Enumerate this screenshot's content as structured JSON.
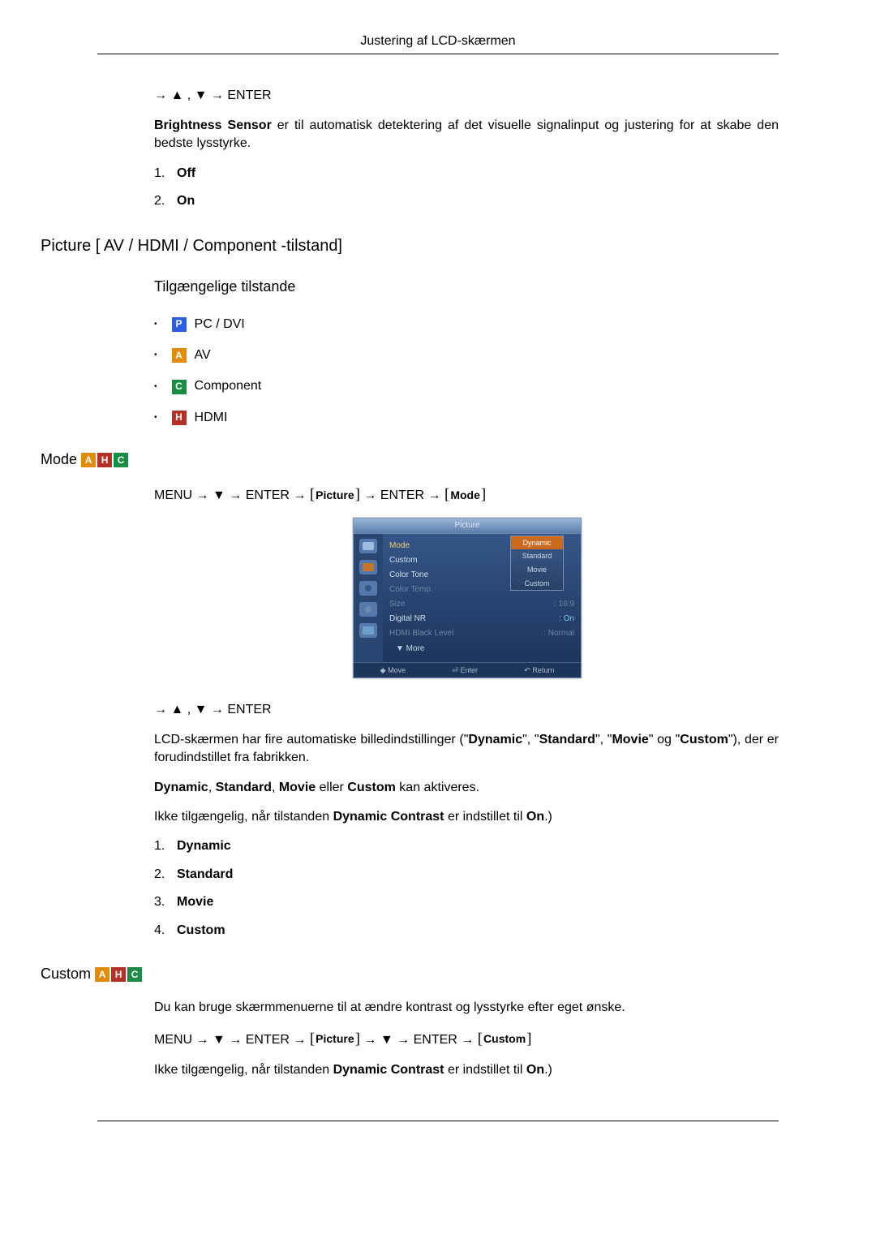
{
  "header": {
    "title": "Justering af LCD-skærmen"
  },
  "section_brightness": {
    "nav": "→ ▲ , ▼ → ENTER",
    "desc_prefix": "Brightness Sensor",
    "desc_rest": "  er til automatisk detektering af det visuelle signalinput og justering for at skabe den bedste lysstyrke.",
    "items": [
      "Off",
      "On"
    ]
  },
  "section_picture": {
    "title": "Picture [ AV / HDMI / Component -tilstand]",
    "subtitle": "Tilgængelige tilstande",
    "modes": [
      {
        "badge": "P",
        "cls": "badge-p",
        "label": "PC / DVI"
      },
      {
        "badge": "A",
        "cls": "badge-a",
        "label": "AV"
      },
      {
        "badge": "C",
        "cls": "badge-c",
        "label": "Component"
      },
      {
        "badge": "H",
        "cls": "badge-h",
        "label": "HDMI"
      }
    ]
  },
  "section_mode": {
    "title": "Mode",
    "nav_plain_1": "MENU → ▼ → ENTER → ",
    "nav_br1": "Picture",
    "nav_plain_2": " → ENTER → ",
    "nav_br2": "Mode",
    "osd": {
      "title": "Picture",
      "rows": [
        {
          "label": "Mode",
          "value": "",
          "high": true
        },
        {
          "label": "Custom",
          "value": ""
        },
        {
          "label": "Color Tone",
          "value": ""
        },
        {
          "label": "Color Temp.",
          "value": "",
          "dim": true
        },
        {
          "label": "Size",
          "value": ": 16:9",
          "dim": true
        },
        {
          "label": "Digital NR",
          "value": ": On"
        },
        {
          "label": "HDMI Black Level",
          "value": ": Normal",
          "dim": true
        }
      ],
      "dropdown": [
        "Dynamic",
        "Standard",
        "Movie",
        "Custom"
      ],
      "dropdown_selected": "Dynamic",
      "more": "▼  More",
      "foot": {
        "move": "◆ Move",
        "enter": "⏎ Enter",
        "ret": "↶ Return"
      }
    },
    "nav2": "→ ▲ , ▼ → ENTER",
    "desc1_a": "LCD-skærmen har fire automatiske billedindstillinger (\"",
    "desc1_b": "Dynamic",
    "desc1_c": "\", \"",
    "desc1_d": "Standard",
    "desc1_e": "\", \"",
    "desc1_f": "Movie",
    "desc1_g": "\" og \"",
    "desc1_h": "Custom",
    "desc1_i": "\"), der er forudindstillet fra fabrikken.",
    "desc2_a": "Dynamic",
    "desc2_b": ", ",
    "desc2_c": "Standard",
    "desc2_d": ", ",
    "desc2_e": "Movie",
    "desc2_f": " eller ",
    "desc2_g": "Custom",
    "desc2_h": " kan aktiveres.",
    "desc3_a": "Ikke tilgængelig, når tilstanden ",
    "desc3_b": "Dynamic Contrast",
    "desc3_c": " er indstillet til ",
    "desc3_d": "On",
    "desc3_e": ".)",
    "list": [
      "Dynamic",
      "Standard",
      "Movie",
      "Custom"
    ]
  },
  "section_custom": {
    "title": "Custom",
    "desc1": "Du kan bruge skærmmenuerne til at ændre kontrast og lysstyrke efter eget ønske.",
    "nav_plain_1": "MENU → ▼ → ENTER → ",
    "nav_br1": "Picture",
    "nav_plain_2": " → ▼ → ENTER → ",
    "nav_br2": "Custom",
    "desc2_a": "Ikke tilgængelig, når tilstanden ",
    "desc2_b": "Dynamic Contrast",
    "desc2_c": " er indstillet til ",
    "desc2_d": "On",
    "desc2_e": ".)"
  },
  "badges_small": {
    "a": "A",
    "h": "H",
    "c": "C"
  }
}
